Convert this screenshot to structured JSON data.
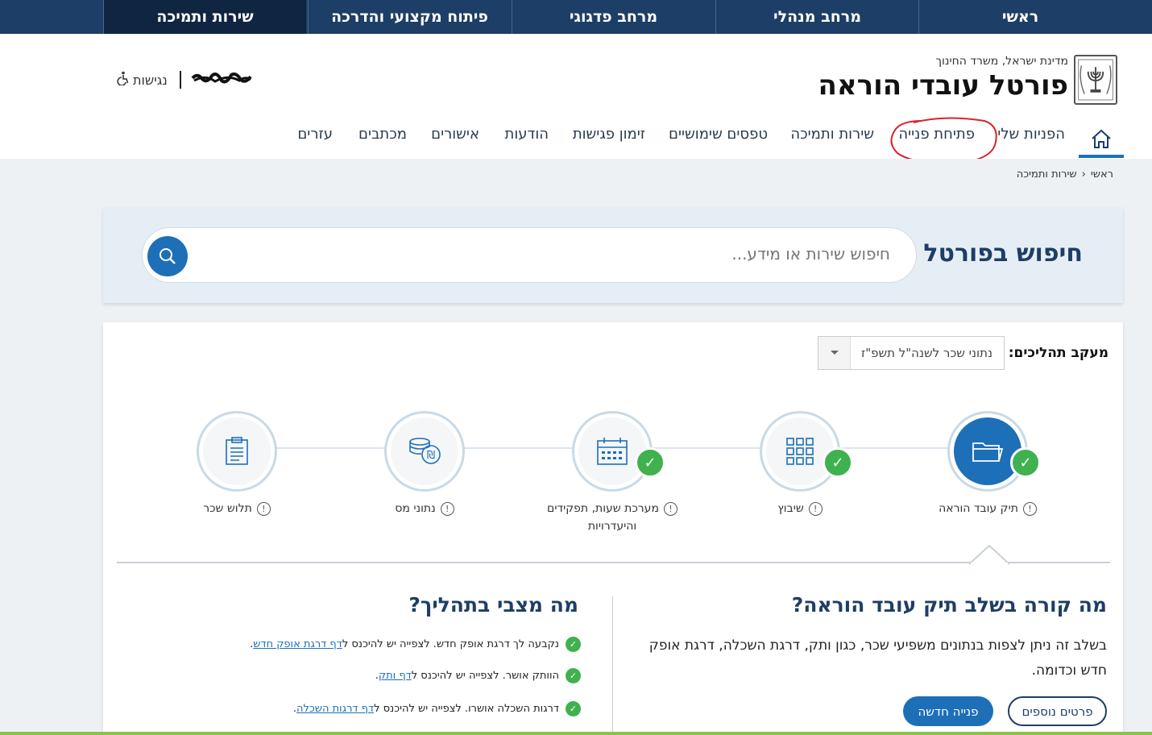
{
  "topbar": {
    "items": [
      "ראשי",
      "מרחב מנהלי",
      "מרחב פדגוגי",
      "פיתוח מקצועי והדרכה",
      "שירות ותמיכה"
    ],
    "active_index": 4
  },
  "header": {
    "ministry": "מדינת ישראל, משרד החינוך",
    "title": "פורטל עובדי הוראה",
    "accessibility": "נגישות"
  },
  "nav": {
    "items": [
      "הפניות שלי",
      "פתיחת פנייה",
      "שירות ותמיכה",
      "טפסים שימושיים",
      "זימון פגישות",
      "הודעות",
      "אישורים",
      "מכתבים",
      "עזרים"
    ],
    "circled_item": "פתיחת פנייה"
  },
  "breadcrumb": {
    "home": "ראשי",
    "current": "שירות ותמיכה"
  },
  "search": {
    "title": "חיפוש בפורטל",
    "placeholder": "חיפוש שירות או מידע..."
  },
  "tracking": {
    "label": "מעקב תהליכים:",
    "selected": "נתוני שכר לשנה\"ל תשפ\"ז",
    "steps": [
      {
        "label": "תיק עובד הוראה",
        "done": true,
        "active": true,
        "icon": "folder-icon"
      },
      {
        "label": "שיבוץ",
        "done": true,
        "active": false,
        "icon": "grid-icon"
      },
      {
        "label": "מערכת שעות, תפקידים והיעדרויות",
        "done": true,
        "active": false,
        "icon": "calendar-icon"
      },
      {
        "label": "נתוני מס",
        "done": false,
        "active": false,
        "icon": "coins-icon"
      },
      {
        "label": "תלוש שכר",
        "done": false,
        "active": false,
        "icon": "clipboard-icon"
      }
    ]
  },
  "details": {
    "heading": "מה קורה בשלב תיק עובד הוראה?",
    "body": "בשלב זה ניתן לצפות בנתונים משפיעי שכר, כגון ותק, דרגת השכלה, דרגת אופק חדש וכדומה.",
    "primary_button": "פנייה חדשה",
    "secondary_button": "פרטים נוספים"
  },
  "status": {
    "heading": "מה מצבי בתהליך?",
    "items": [
      {
        "text": "נקבעה לך דרגת אופק חדש. לצפייה יש להיכנס ל",
        "link": "דף דרגת אופק חדש",
        "suffix": "."
      },
      {
        "text": "הוותק אושר. לצפייה יש להיכנס ל",
        "link": "דף ותק",
        "suffix": "."
      },
      {
        "text": "דרגות השכלה אושרו. לצפייה יש להיכנס ל",
        "link": "דף דרגות השכלה",
        "suffix": "."
      }
    ]
  },
  "colors": {
    "navy": "#1d3e66",
    "blue": "#1d6fb8",
    "green": "#3fb14e",
    "annotation_red": "#d9232d"
  }
}
